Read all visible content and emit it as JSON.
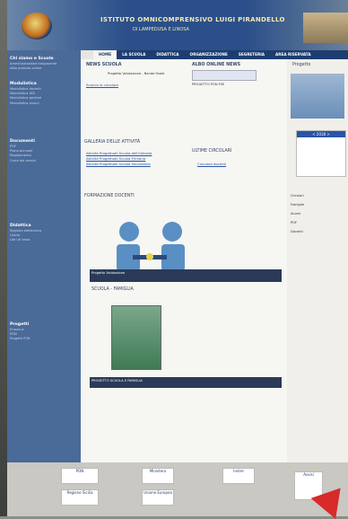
{
  "header": {
    "title": "ISTITUTO OMNICOMPRENSIVO LUIGI PIRANDELLO",
    "subtitle": "DI LAMPEDUSA E LINOSA"
  },
  "nav": [
    "HOME",
    "LA SCUOLA",
    "DIDATTICA",
    "ORGANIZZAZIONE",
    "SEGRETERIA",
    "AREA RISERVATA"
  ],
  "sidebar": {
    "sections": [
      {
        "title": "Chi siamo e Scuole",
        "items": [
          "Amministrazione trasparente",
          "Albo pretorio online"
        ]
      },
      {
        "title": "Modulistica",
        "items": [
          "Modulistica docenti",
          "Modulistica ATA",
          "Modulistica genitori",
          "Modulistica alunni"
        ]
      },
      {
        "title": "Documenti",
        "items": [
          "POF",
          "Piano annuale",
          "Regolamento",
          "Carta dei servizi"
        ]
      },
      {
        "title": "Didattica",
        "items": [
          "Registro elettronico",
          "Orario",
          "Libri di testo"
        ]
      },
      {
        "title": "Progetti",
        "items": [
          "Erasmus",
          "PON",
          "Progetti POR"
        ]
      }
    ]
  },
  "main": {
    "news_title": "NEWS SCUOLA",
    "news_item": "Progetto Valutazione - Bando finale",
    "news_link": "Scarica la circolare",
    "albo_title": "ALBO ONLINE NEWS",
    "albo_text": "PROGETTO PON FSE",
    "gallery_title": "GALLERIA DELLE ATTIVITÀ",
    "gallery_links": [
      "Attività Progettuali Scuola dell'Infanzia",
      "Attività Progettuali Scuola Primaria",
      "Attività Progettuali Scuola Secondaria"
    ],
    "circolari_title": "ULTIME CIRCOLARI",
    "circolari_link": "Circolare docenti",
    "formazione_title": "FORMAZIONE DOCENTI",
    "formazione_caption": "Progetto Valutazione",
    "famiglia_title": "SCUOLA - FAMIGLIA",
    "famiglia_caption": "PROGETTO SCUOLA E FAMIGLIA"
  },
  "right": {
    "title": "Progetto",
    "calendar_title": "< 2018 >",
    "items": [
      "Circolari",
      "Famiglie",
      "Alunni",
      "POF",
      "Docenti"
    ]
  },
  "footer": {
    "logos": [
      "PON",
      "Ministero",
      "Indire",
      "Regione Sicilia",
      "Unione Europea",
      "Avvisi"
    ]
  }
}
